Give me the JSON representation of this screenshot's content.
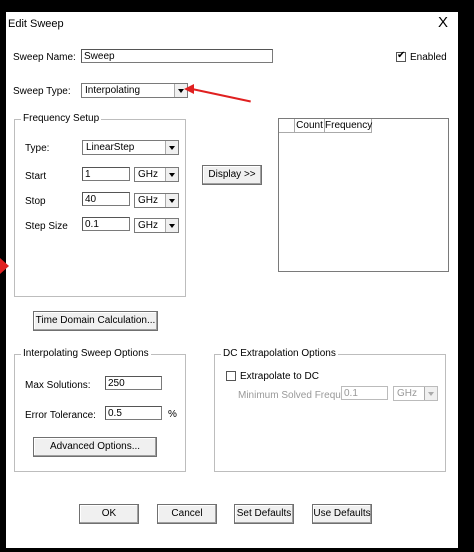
{
  "window": {
    "title": "Edit Sweep",
    "close_glyph": "X"
  },
  "sweep": {
    "name_label": "Sweep Name:",
    "name_value": "Sweep",
    "enabled_label": "Enabled",
    "enabled_checked": true,
    "type_label": "Sweep Type:",
    "type_value": "Interpolating"
  },
  "frequency_setup": {
    "legend": "Frequency Setup",
    "type_label": "Type:",
    "type_value": "LinearStep",
    "start_label": "Start",
    "start_value": "1",
    "start_unit": "GHz",
    "stop_label": "Stop",
    "stop_value": "40",
    "stop_unit": "GHz",
    "stepsize_label": "Step Size",
    "stepsize_value": "0.1",
    "stepsize_unit": "GHz"
  },
  "display_button": "Display >>",
  "table": {
    "columns": [
      "Count",
      "Frequency"
    ]
  },
  "time_domain_button": "Time Domain Calculation...",
  "interpolating": {
    "legend": "Interpolating Sweep Options",
    "max_solutions_label": "Max Solutions:",
    "max_solutions_value": "250",
    "error_tolerance_label": "Error Tolerance:",
    "error_tolerance_value": "0.5",
    "error_tolerance_unit": "%",
    "advanced_button": "Advanced Options..."
  },
  "dc_extrapolation": {
    "legend": "DC Extrapolation Options",
    "extrapolate_label": "Extrapolate to DC",
    "extrapolate_checked": false,
    "min_freq_label": "Minimum Solved Frequency",
    "min_freq_value": "0.1",
    "min_freq_unit": "GHz"
  },
  "footer": {
    "ok": "OK",
    "cancel": "Cancel",
    "set_defaults": "Set Defaults",
    "use_defaults": "Use Defaults"
  },
  "colors": {
    "annotation_arrow": "#e02020"
  }
}
